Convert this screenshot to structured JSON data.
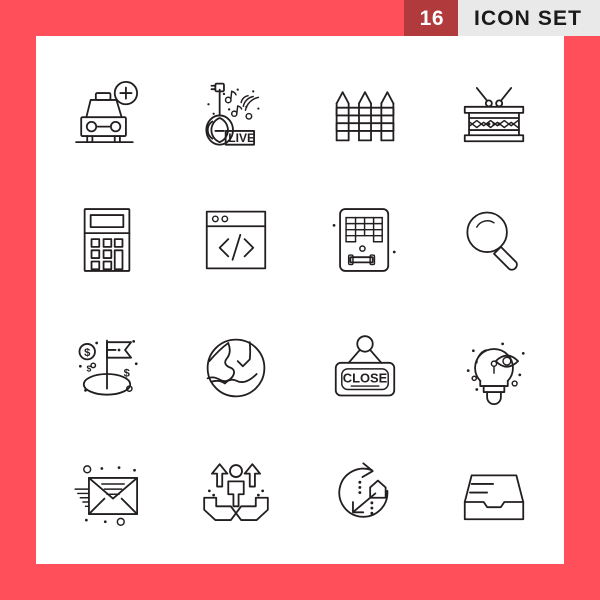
{
  "header": {
    "count": "16",
    "title": "ICON SET",
    "count_bg": "#b03a3c",
    "title_bg": "#e9e9e9",
    "count_color": "#ffffff",
    "title_color": "#1a1a1a"
  },
  "poster": {
    "frame_color": "#ff4f5a",
    "panel_color": "#ffffff",
    "icon_stroke_color": "#231f20",
    "grid_rows": 4,
    "grid_cols": 4,
    "icon_count": 16
  },
  "icons": [
    {
      "id": 1,
      "name": "add-taxi-icon",
      "label": "Add Car",
      "row": 1,
      "col": 1,
      "inline_text": ""
    },
    {
      "id": 2,
      "name": "live-music-guitar-icon",
      "label": "Live Music",
      "row": 1,
      "col": 2,
      "inline_text": "LIVE"
    },
    {
      "id": 3,
      "name": "fence-icon",
      "label": "Fence",
      "row": 1,
      "col": 3,
      "inline_text": ""
    },
    {
      "id": 4,
      "name": "drum-icon",
      "label": "Drum",
      "row": 1,
      "col": 4,
      "inline_text": ""
    },
    {
      "id": 5,
      "name": "calculator-icon",
      "label": "Calculator",
      "row": 2,
      "col": 1,
      "inline_text": ""
    },
    {
      "id": 6,
      "name": "code-window-icon",
      "label": "Code Window",
      "row": 2,
      "col": 2,
      "inline_text": ""
    },
    {
      "id": 7,
      "name": "brick-breaker-game-icon",
      "label": "Brick Game",
      "row": 2,
      "col": 3,
      "inline_text": ""
    },
    {
      "id": 8,
      "name": "magnifier-icon",
      "label": "Search",
      "row": 2,
      "col": 4,
      "inline_text": ""
    },
    {
      "id": 9,
      "name": "money-flag-goal-icon",
      "label": "Financial Goal",
      "row": 3,
      "col": 1,
      "inline_text": ""
    },
    {
      "id": 10,
      "name": "globe-icon",
      "label": "Globe",
      "row": 3,
      "col": 2,
      "inline_text": ""
    },
    {
      "id": 11,
      "name": "close-sign-icon",
      "label": "Close Sign",
      "row": 3,
      "col": 3,
      "inline_text": "CLOSE"
    },
    {
      "id": 12,
      "name": "idea-vision-bulb-icon",
      "label": "Vision Idea",
      "row": 3,
      "col": 4,
      "inline_text": ""
    },
    {
      "id": 13,
      "name": "fast-mail-envelope-icon",
      "label": "Fast Mail",
      "row": 4,
      "col": 1,
      "inline_text": ""
    },
    {
      "id": 14,
      "name": "employee-support-icon",
      "label": "Employee Support",
      "row": 4,
      "col": 2,
      "inline_text": ""
    },
    {
      "id": 15,
      "name": "relocation-arrows-icon",
      "label": "Relocation",
      "row": 4,
      "col": 3,
      "inline_text": ""
    },
    {
      "id": 16,
      "name": "inbox-tray-icon",
      "label": "Inbox Tray",
      "row": 4,
      "col": 4,
      "inline_text": ""
    }
  ]
}
